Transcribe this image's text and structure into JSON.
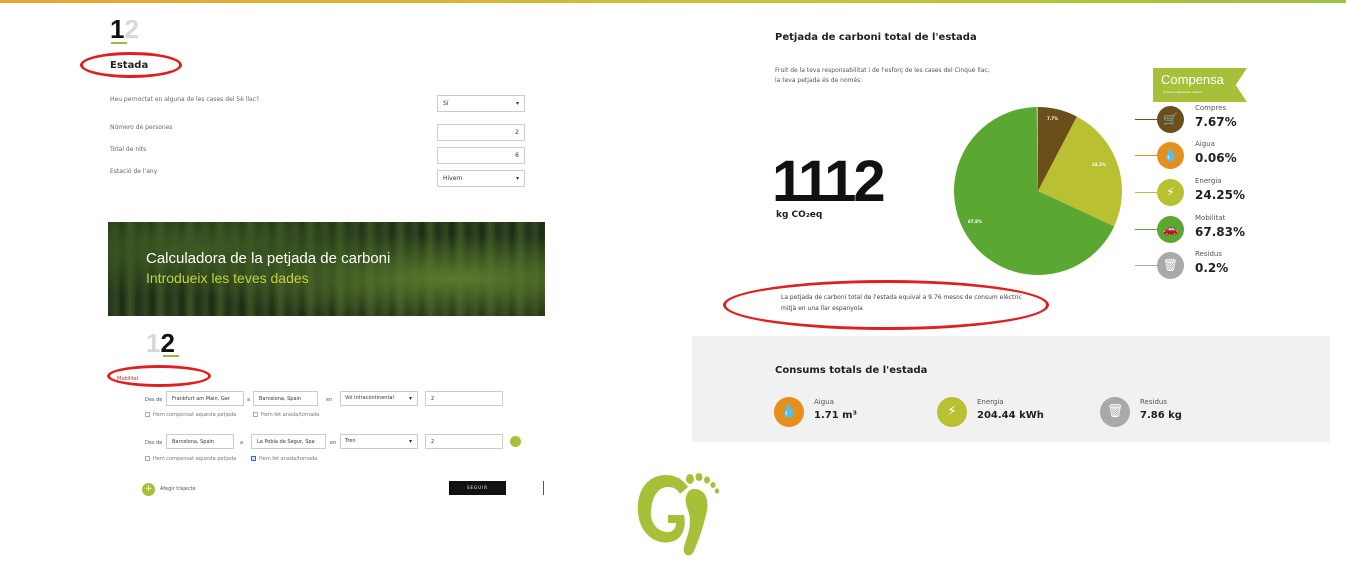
{
  "step_one": {
    "active": "1",
    "inactive": "2"
  },
  "stay": {
    "title": "Estada",
    "questions": [
      {
        "label": "Heu pernoctat en alguna de les cases del 5è llac?",
        "value": "Sí",
        "kind": "select"
      },
      {
        "label": "Número de persones",
        "value": "2",
        "kind": "input"
      },
      {
        "label": "Total de nits",
        "value": "6",
        "kind": "input"
      },
      {
        "label": "Estació de l'any",
        "value": "Hivern",
        "kind": "select"
      }
    ]
  },
  "banner": {
    "title": "Calculadora de la petjada de carboni",
    "subtitle": "Introdueix les teves dades"
  },
  "step_two": {
    "inactive": "1",
    "active": "2"
  },
  "mobility": {
    "title": "Mobilitat",
    "trips": [
      {
        "from_label": "Des de",
        "from": "Frankfurt am Main, Ger",
        "to_label": "a",
        "to": "Barcelona, Spain",
        "mode_label": "en",
        "mode": "Vol intracontinental",
        "count": "2",
        "check1": "Hem compensat aquesta petjada",
        "check2": "Hem fet anada/tornada"
      },
      {
        "from_label": "Des de",
        "from": "Barcelona, Spain",
        "to_label": "a",
        "to": "La Pobla de Segur, Spa",
        "mode_label": "en",
        "mode": "Tren",
        "count": "2",
        "check1": "Hem compensat aquesta petjada",
        "check2": "Hem fet anada/tornada"
      }
    ],
    "add_trip": "Afegir trajecte",
    "next": "SEGUIR"
  },
  "result": {
    "title": "Petjada de carboni total de l'estada",
    "description": "Fruit de la teva responsabilitat i de l'esforç de les cases del Cinquè llac, la teva petjada és de només:",
    "total": "1112",
    "unit": "kg CO₂eq",
    "note": "La petjada de carboni total de l'estada equival a 9.76 mesos de consum elèctric mitjà en una llar espanyola",
    "compensa": {
      "title": "Compensa",
      "subtitle": "la teva petjada de carboni"
    },
    "categories": [
      {
        "name": "Compres",
        "pct": "7.67%",
        "value": 7.67,
        "color": "#6b4e1a",
        "icon": "cart-icon",
        "glyph": "🛒"
      },
      {
        "name": "Aigua",
        "pct": "0.06%",
        "value": 0.06,
        "color": "#e58f1c",
        "icon": "water-drop-icon",
        "glyph": "💧"
      },
      {
        "name": "Energia",
        "pct": "24.25%",
        "value": 24.25,
        "color": "#b9c133",
        "icon": "lightning-icon",
        "glyph": "⚡"
      },
      {
        "name": "Mobilitat",
        "pct": "67.83%",
        "value": 67.83,
        "color": "#5aa832",
        "icon": "car-icon",
        "glyph": "🚗"
      },
      {
        "name": "Residus",
        "pct": "0.2%",
        "value": 0.2,
        "color": "#a9a9a9",
        "icon": "trash-icon",
        "glyph": "🗑"
      }
    ],
    "pie_labels": {
      "compres": "7.7%",
      "energia": "24.3%",
      "mobilitat": "67.8%"
    }
  },
  "totals": {
    "title": "Consums totals de l'estada",
    "items": [
      {
        "name": "Aigua",
        "value": "1.71 m³",
        "color": "#e58f1c",
        "icon": "water-drop-icon",
        "glyph": "💧"
      },
      {
        "name": "Energia",
        "value": "204.44 kWh",
        "color": "#b9c133",
        "icon": "lightning-icon",
        "glyph": "⚡"
      },
      {
        "name": "Residus",
        "value": "7.86 kg",
        "color": "#a9a9a9",
        "icon": "trash-icon",
        "glyph": "🗑"
      }
    ]
  }
}
